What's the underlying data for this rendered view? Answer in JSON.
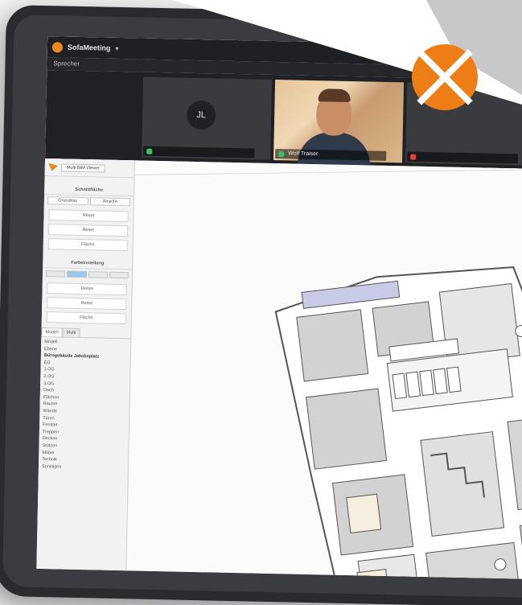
{
  "app": {
    "title": "SofaMeeting",
    "menu": "Sprecher"
  },
  "participants": [
    {
      "initials": "JL",
      "name": "",
      "mic": "on"
    },
    {
      "initials": "",
      "name": "Wolf Traiser",
      "mic": "on"
    },
    {
      "initials": "",
      "name": "",
      "mic": "off"
    }
  ],
  "viewer": {
    "brand_button": "Multi BIM Viewer",
    "panel1": {
      "title": "Schnittfläche",
      "tabs": [
        "Grundriss",
        "Ansicht"
      ],
      "buttons": [
        "Reset",
        "Reset",
        "Fläche"
      ]
    },
    "panel2": {
      "title": "Farbeinstellung",
      "buttons": [
        "Reset",
        "Reset",
        "Fläche"
      ]
    },
    "tree_tabs": [
      "Modell",
      "Multi"
    ],
    "tree": [
      "Modell",
      "Ebene",
      "Bürogebäude Jakobsplatz",
      "EG",
      "1.OG",
      "2.OG",
      "3.OG",
      "Dach",
      "Flächen",
      "Räume",
      "Wände",
      "Türen",
      "Fenster",
      "Treppen",
      "Decken",
      "Stützen",
      "Möbel",
      "Technik",
      "Sonstiges"
    ]
  },
  "colors": {
    "accent": "#ef7d16",
    "chrome": "#202124"
  }
}
